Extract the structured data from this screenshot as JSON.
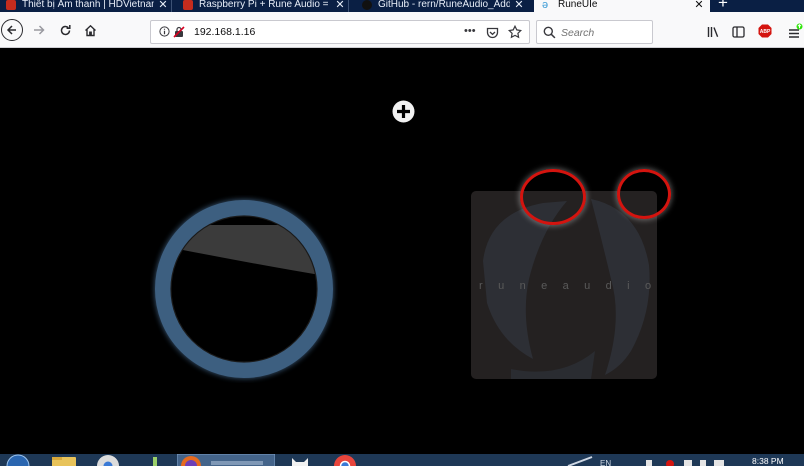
{
  "browser": {
    "tabs": [
      {
        "title": "Thiết bị Âm thanh | HDVietnam",
        "favicon_color": "#c42c1e",
        "active": false
      },
      {
        "title": "Raspberry Pi + Rune Audio = M",
        "favicon_color": "#c42c1e",
        "active": false
      },
      {
        "title": "GitHub - rern/RuneAudio_Addo",
        "favicon_color": "#111111",
        "active": false
      },
      {
        "title": "RuneUIe",
        "favicon_color": "#3a9bd6",
        "active": true
      }
    ],
    "new_tab_label": "+",
    "close_glyph": "✕"
  },
  "navbar": {
    "url": "192.168.1.16",
    "page_actions": "•••",
    "search_placeholder": "Search",
    "icons": [
      "back-icon",
      "forward-icon",
      "reload-icon",
      "home-icon",
      "info-icon",
      "insecure-icon",
      "pocket-icon",
      "bookmark-star-icon",
      "search-icon",
      "library-icon",
      "sidebar-icon",
      "adblock-icon",
      "menu-icon"
    ]
  },
  "page": {
    "brand_text": "runeaudio",
    "colors": {
      "background": "#000000",
      "knob_ring": "#3e5f80",
      "card": "#242121",
      "annotation": "#d4140f"
    }
  },
  "taskbar": {
    "clock": "8:38 PM",
    "language": "EN",
    "icons": [
      "start-icon",
      "explorer-icon",
      "chrome-icon",
      "app-icon",
      "firefox-icon",
      "cat-icon",
      "chrome-icon-2"
    ]
  }
}
